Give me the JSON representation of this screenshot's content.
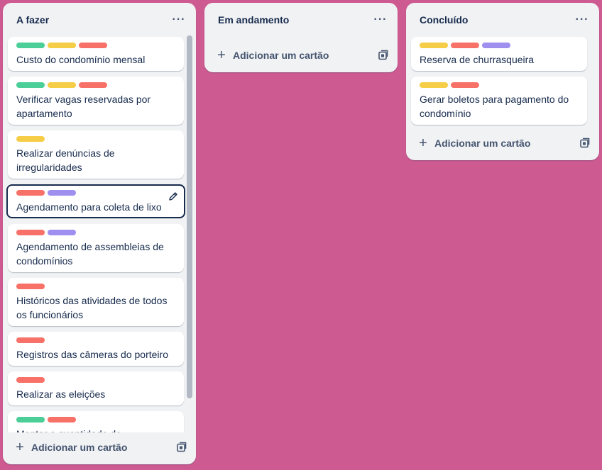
{
  "colors": {
    "background": "#cd5a91",
    "green": "#4bce97",
    "yellow": "#f5cd47",
    "red": "#f87168",
    "purple": "#9f8fef"
  },
  "icons": {
    "more": "more-horizontal-icon",
    "add": "plus-icon",
    "template": "template-icon",
    "edit": "pencil-icon"
  },
  "add_card_label": "Adicionar um cartão",
  "lists": [
    {
      "title": "A fazer",
      "cards": [
        {
          "labels": [
            "green",
            "yellow",
            "red"
          ],
          "title": "Custo do condomínio mensal"
        },
        {
          "labels": [
            "green",
            "yellow",
            "red"
          ],
          "title": "Verificar vagas reservadas por apartamento"
        },
        {
          "labels": [
            "yellow"
          ],
          "title": "Realizar denúncias de irregularidades"
        },
        {
          "labels": [
            "red",
            "purple"
          ],
          "title": "Agendamento para coleta de lixo"
        },
        {
          "labels": [
            "red",
            "purple"
          ],
          "title": "Agendamento de assembleias de condomínios"
        },
        {
          "labels": [
            "red"
          ],
          "title": "Históricos das atividades de todos os funcionários"
        },
        {
          "labels": [
            "red"
          ],
          "title": "Registros das câmeras do porteiro"
        },
        {
          "labels": [
            "red"
          ],
          "title": "Realizar as eleições"
        },
        {
          "labels": [
            "green",
            "red"
          ],
          "title": "Montar a quantidade de"
        }
      ]
    },
    {
      "title": "Em andamento",
      "cards": []
    },
    {
      "title": "Concluído",
      "cards": [
        {
          "labels": [
            "yellow",
            "red",
            "purple"
          ],
          "title": "Reserva de churrasqueira"
        },
        {
          "labels": [
            "yellow",
            "red"
          ],
          "title": "Gerar boletos para pagamento do condomínio"
        }
      ]
    }
  ]
}
